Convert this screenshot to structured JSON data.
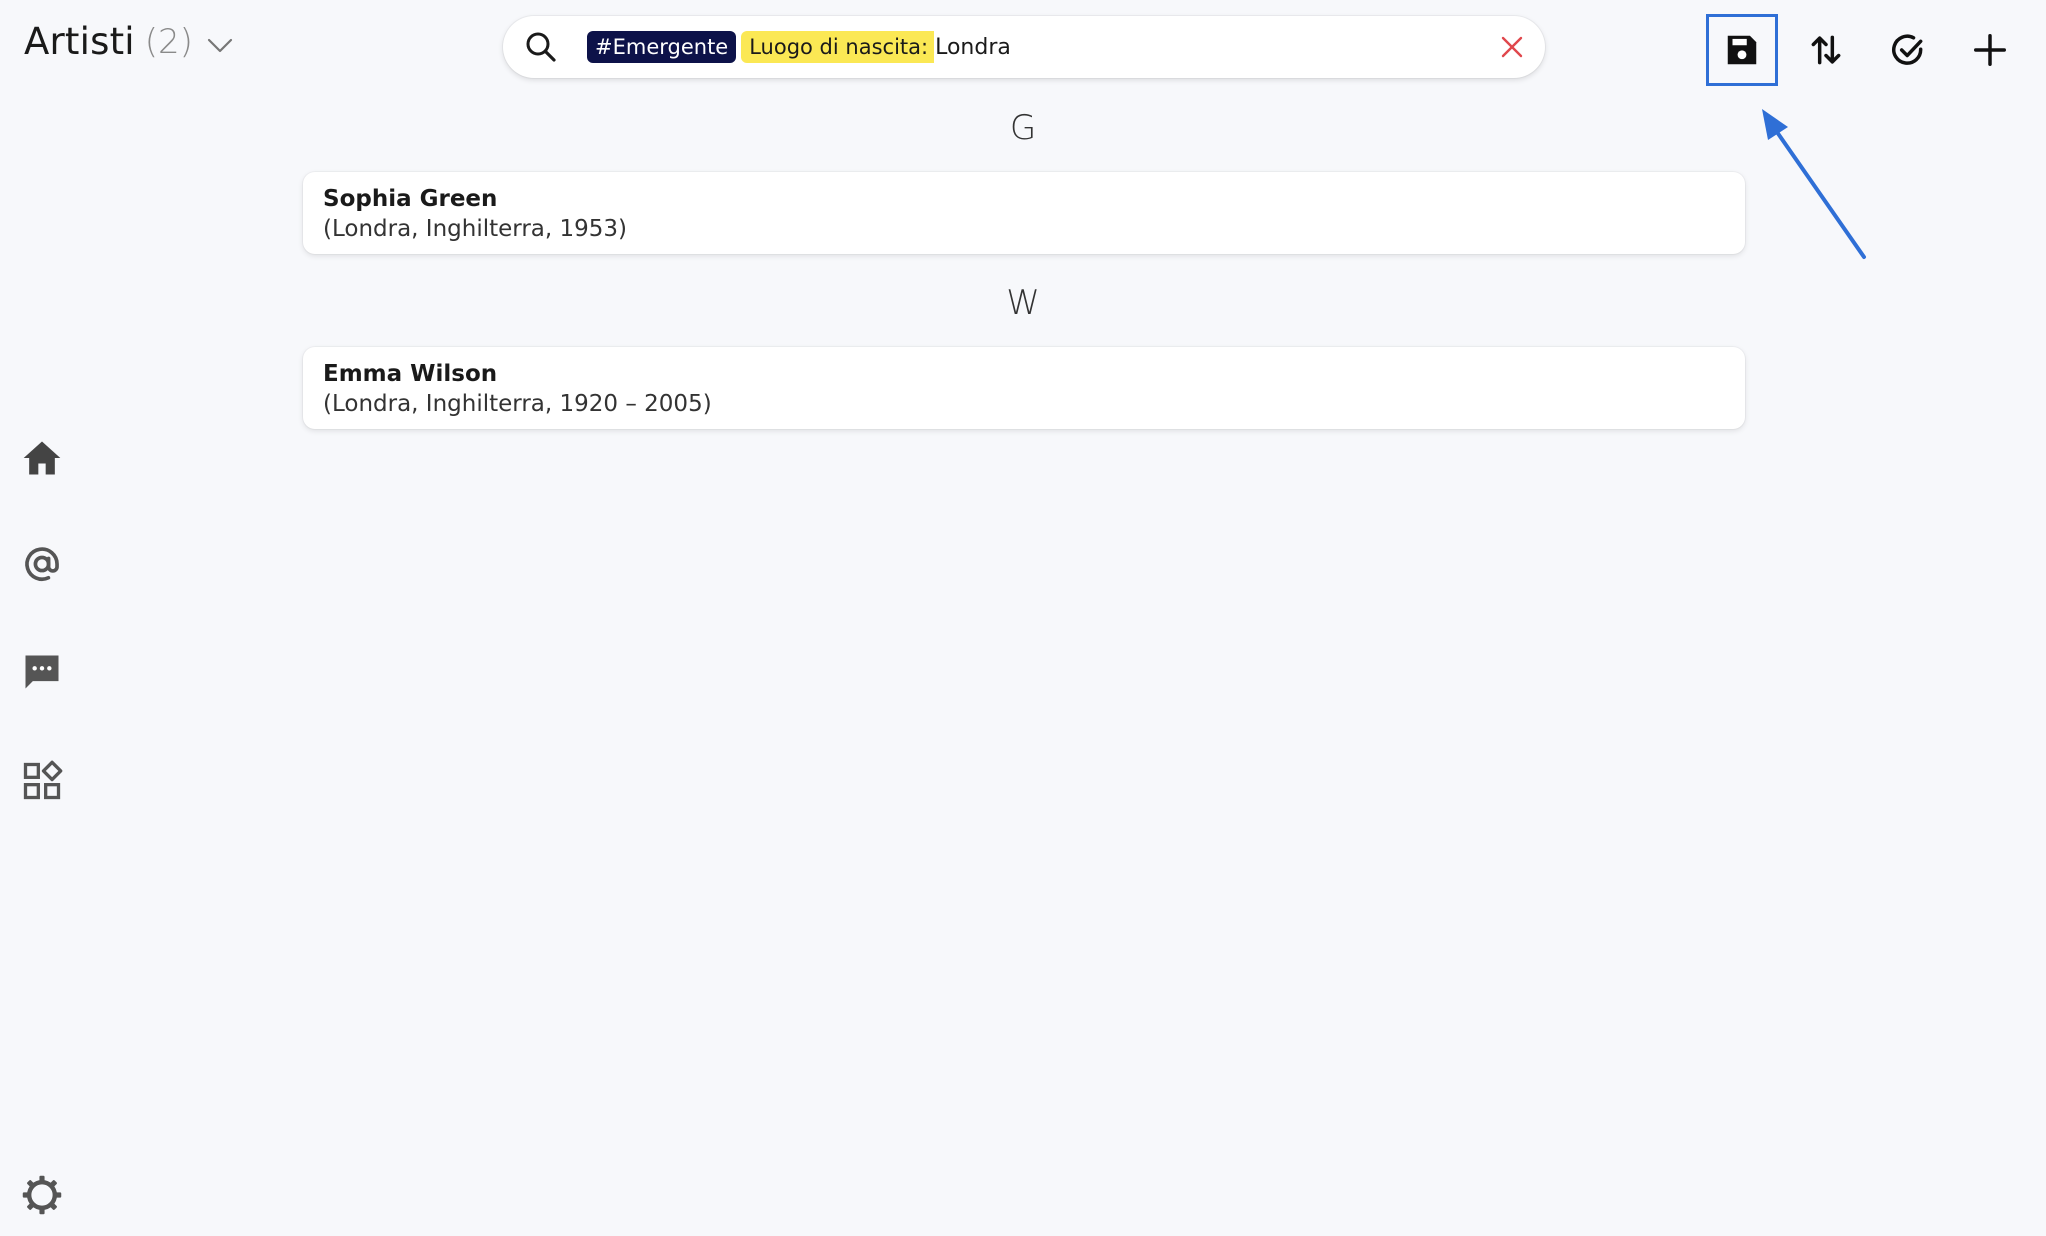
{
  "header": {
    "title": "Artisti",
    "count": "(2)"
  },
  "search": {
    "tag": "#Emergente",
    "filter_label": "Luogo di nascita:",
    "filter_value": "Londra"
  },
  "toolbar": {
    "icons": [
      "save-icon",
      "sort-icon",
      "select-icon",
      "add-icon"
    ]
  },
  "sidebar": {
    "icons": [
      "home-icon",
      "at-icon",
      "chat-icon",
      "widgets-icon",
      "settings-icon"
    ]
  },
  "sections": [
    {
      "letter": "G",
      "items": [
        {
          "name": "Sophia Green",
          "detail": "(Londra, Inghilterra, 1953)"
        }
      ]
    },
    {
      "letter": "W",
      "items": [
        {
          "name": "Emma Wilson",
          "detail": "(Londra, Inghilterra, 1920 – 2005)"
        }
      ]
    }
  ],
  "colors": {
    "accent": "#2f6fd6",
    "tag_dark": "#0d1249",
    "tag_yellow": "#fbe854",
    "clear": "#e0474c"
  }
}
